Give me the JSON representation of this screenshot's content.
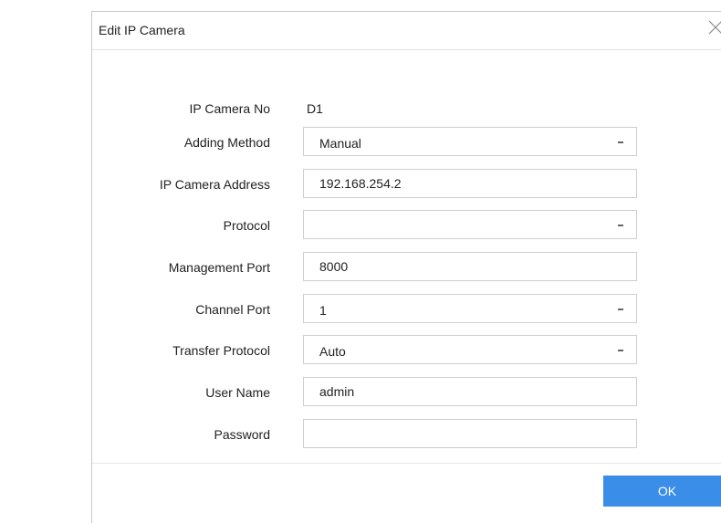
{
  "dialog": {
    "title": "Edit IP Camera",
    "ok_label": "OK"
  },
  "fields": {
    "camera_no": {
      "label": "IP Camera No",
      "value": "D1"
    },
    "adding_method": {
      "label": "Adding Method",
      "value": "Manual"
    },
    "address": {
      "label": "IP Camera Address",
      "value": "192.168.254.2"
    },
    "protocol": {
      "label": "Protocol",
      "value": ""
    },
    "management_port": {
      "label": "Management Port",
      "value": "8000"
    },
    "channel_port": {
      "label": "Channel Port",
      "value": "1"
    },
    "transfer_protocol": {
      "label": "Transfer Protocol",
      "value": "Auto"
    },
    "user_name": {
      "label": "User Name",
      "value": "admin"
    },
    "password": {
      "label": "Password",
      "value": ""
    }
  },
  "colors": {
    "accent": "#3b8ee8",
    "border": "#cfcfcf"
  },
  "icons": {
    "close": "close-icon",
    "dropdown": "chevron-down-icon"
  }
}
